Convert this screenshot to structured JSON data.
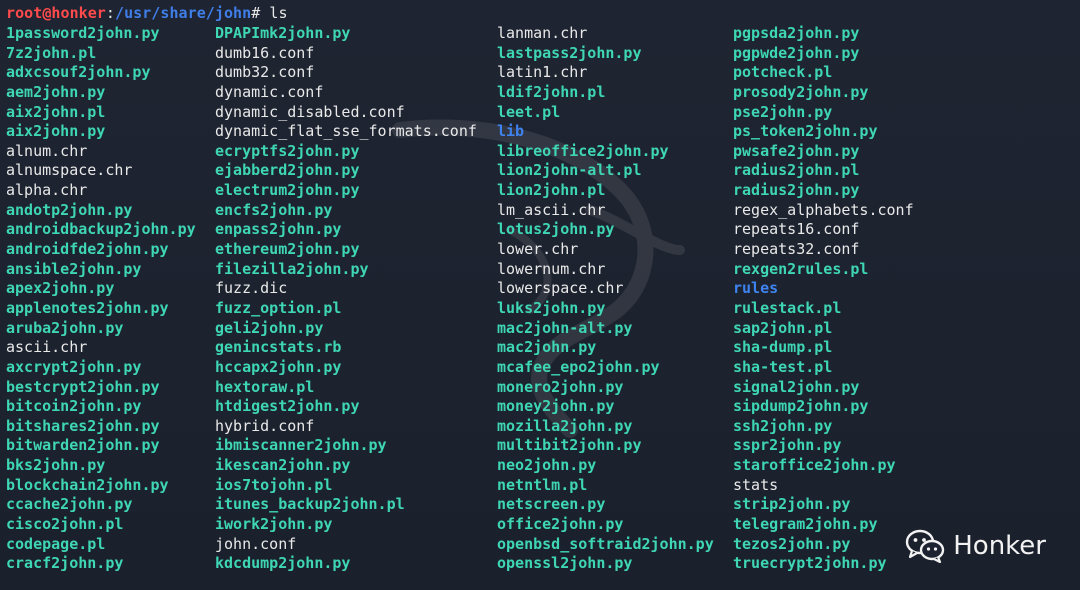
{
  "prompt": {
    "user_host": "root@honker",
    "separator": ":",
    "path": "/usr/share/john",
    "symbol": "#",
    "command": "ls"
  },
  "watermark": {
    "text": "Honker",
    "icon": "wechat-icon",
    "background_icon": "kali-dragon-icon"
  },
  "colors": {
    "background": "#1d2330",
    "executable": "#3ed6b4",
    "directory": "#3e83f0",
    "plain": "#e9e9e9",
    "prompt_user": "#ff4b4b"
  },
  "columns": [
    [
      {
        "name": "1password2john.py",
        "type": "exec"
      },
      {
        "name": "7z2john.pl",
        "type": "exec"
      },
      {
        "name": "adxcsouf2john.py",
        "type": "exec"
      },
      {
        "name": "aem2john.py",
        "type": "exec"
      },
      {
        "name": "aix2john.pl",
        "type": "exec"
      },
      {
        "name": "aix2john.py",
        "type": "exec"
      },
      {
        "name": "alnum.chr",
        "type": "plain"
      },
      {
        "name": "alnumspace.chr",
        "type": "plain"
      },
      {
        "name": "alpha.chr",
        "type": "plain"
      },
      {
        "name": "andotp2john.py",
        "type": "exec"
      },
      {
        "name": "androidbackup2john.py",
        "type": "exec"
      },
      {
        "name": "androidfde2john.py",
        "type": "exec"
      },
      {
        "name": "ansible2john.py",
        "type": "exec"
      },
      {
        "name": "apex2john.py",
        "type": "exec"
      },
      {
        "name": "applenotes2john.py",
        "type": "exec"
      },
      {
        "name": "aruba2john.py",
        "type": "exec"
      },
      {
        "name": "ascii.chr",
        "type": "plain"
      },
      {
        "name": "axcrypt2john.py",
        "type": "exec"
      },
      {
        "name": "bestcrypt2john.py",
        "type": "exec"
      },
      {
        "name": "bitcoin2john.py",
        "type": "exec"
      },
      {
        "name": "bitshares2john.py",
        "type": "exec"
      },
      {
        "name": "bitwarden2john.py",
        "type": "exec"
      },
      {
        "name": "bks2john.py",
        "type": "exec"
      },
      {
        "name": "blockchain2john.py",
        "type": "exec"
      },
      {
        "name": "ccache2john.py",
        "type": "exec"
      },
      {
        "name": "cisco2john.pl",
        "type": "exec"
      },
      {
        "name": "codepage.pl",
        "type": "exec"
      },
      {
        "name": "cracf2john.py",
        "type": "exec"
      }
    ],
    [
      {
        "name": "DPAPImk2john.py",
        "type": "exec"
      },
      {
        "name": "dumb16.conf",
        "type": "plain"
      },
      {
        "name": "dumb32.conf",
        "type": "plain"
      },
      {
        "name": "dynamic.conf",
        "type": "plain"
      },
      {
        "name": "dynamic_disabled.conf",
        "type": "plain"
      },
      {
        "name": "dynamic_flat_sse_formats.conf",
        "type": "plain"
      },
      {
        "name": "ecryptfs2john.py",
        "type": "exec"
      },
      {
        "name": "ejabberd2john.py",
        "type": "exec"
      },
      {
        "name": "electrum2john.py",
        "type": "exec"
      },
      {
        "name": "encfs2john.py",
        "type": "exec"
      },
      {
        "name": "enpass2john.py",
        "type": "exec"
      },
      {
        "name": "ethereum2john.py",
        "type": "exec"
      },
      {
        "name": "filezilla2john.py",
        "type": "exec"
      },
      {
        "name": "fuzz.dic",
        "type": "plain"
      },
      {
        "name": "fuzz_option.pl",
        "type": "exec"
      },
      {
        "name": "geli2john.py",
        "type": "exec"
      },
      {
        "name": "genincstats.rb",
        "type": "exec"
      },
      {
        "name": "hccapx2john.py",
        "type": "exec"
      },
      {
        "name": "hextoraw.pl",
        "type": "exec"
      },
      {
        "name": "htdigest2john.py",
        "type": "exec"
      },
      {
        "name": "hybrid.conf",
        "type": "plain"
      },
      {
        "name": "ibmiscanner2john.py",
        "type": "exec"
      },
      {
        "name": "ikescan2john.py",
        "type": "exec"
      },
      {
        "name": "ios7tojohn.pl",
        "type": "exec"
      },
      {
        "name": "itunes_backup2john.pl",
        "type": "exec"
      },
      {
        "name": "iwork2john.py",
        "type": "exec"
      },
      {
        "name": "john.conf",
        "type": "plain"
      },
      {
        "name": "kdcdump2john.py",
        "type": "exec"
      }
    ],
    [
      {
        "name": "lanman.chr",
        "type": "plain"
      },
      {
        "name": "lastpass2john.py",
        "type": "exec"
      },
      {
        "name": "latin1.chr",
        "type": "plain"
      },
      {
        "name": "ldif2john.pl",
        "type": "exec"
      },
      {
        "name": "leet.pl",
        "type": "exec"
      },
      {
        "name": "lib",
        "type": "dir"
      },
      {
        "name": "libreoffice2john.py",
        "type": "exec"
      },
      {
        "name": "lion2john-alt.pl",
        "type": "exec"
      },
      {
        "name": "lion2john.pl",
        "type": "exec"
      },
      {
        "name": "lm_ascii.chr",
        "type": "plain"
      },
      {
        "name": "lotus2john.py",
        "type": "exec"
      },
      {
        "name": "lower.chr",
        "type": "plain"
      },
      {
        "name": "lowernum.chr",
        "type": "plain"
      },
      {
        "name": "lowerspace.chr",
        "type": "plain"
      },
      {
        "name": "luks2john.py",
        "type": "exec"
      },
      {
        "name": "mac2john-alt.py",
        "type": "exec"
      },
      {
        "name": "mac2john.py",
        "type": "exec"
      },
      {
        "name": "mcafee_epo2john.py",
        "type": "exec"
      },
      {
        "name": "monero2john.py",
        "type": "exec"
      },
      {
        "name": "money2john.py",
        "type": "exec"
      },
      {
        "name": "mozilla2john.py",
        "type": "exec"
      },
      {
        "name": "multibit2john.py",
        "type": "exec"
      },
      {
        "name": "neo2john.py",
        "type": "exec"
      },
      {
        "name": "netntlm.pl",
        "type": "exec"
      },
      {
        "name": "netscreen.py",
        "type": "exec"
      },
      {
        "name": "office2john.py",
        "type": "exec"
      },
      {
        "name": "openbsd_softraid2john.py",
        "type": "exec"
      },
      {
        "name": "openssl2john.py",
        "type": "exec"
      }
    ],
    [
      {
        "name": "pgpsda2john.py",
        "type": "exec"
      },
      {
        "name": "pgpwde2john.py",
        "type": "exec"
      },
      {
        "name": "potcheck.pl",
        "type": "exec"
      },
      {
        "name": "prosody2john.py",
        "type": "exec"
      },
      {
        "name": "pse2john.py",
        "type": "exec"
      },
      {
        "name": "ps_token2john.py",
        "type": "exec"
      },
      {
        "name": "pwsafe2john.py",
        "type": "exec"
      },
      {
        "name": "radius2john.pl",
        "type": "exec"
      },
      {
        "name": "radius2john.py",
        "type": "exec"
      },
      {
        "name": "regex_alphabets.conf",
        "type": "plain"
      },
      {
        "name": "repeats16.conf",
        "type": "plain"
      },
      {
        "name": "repeats32.conf",
        "type": "plain"
      },
      {
        "name": "rexgen2rules.pl",
        "type": "exec"
      },
      {
        "name": "rules",
        "type": "dir"
      },
      {
        "name": "rulestack.pl",
        "type": "exec"
      },
      {
        "name": "sap2john.pl",
        "type": "exec"
      },
      {
        "name": "sha-dump.pl",
        "type": "exec"
      },
      {
        "name": "sha-test.pl",
        "type": "exec"
      },
      {
        "name": "signal2john.py",
        "type": "exec"
      },
      {
        "name": "sipdump2john.py",
        "type": "exec"
      },
      {
        "name": "ssh2john.py",
        "type": "exec"
      },
      {
        "name": "sspr2john.py",
        "type": "exec"
      },
      {
        "name": "staroffice2john.py",
        "type": "exec"
      },
      {
        "name": "stats",
        "type": "plain"
      },
      {
        "name": "strip2john.py",
        "type": "exec"
      },
      {
        "name": "telegram2john.py",
        "type": "exec"
      },
      {
        "name": "tezos2john.py",
        "type": "exec"
      },
      {
        "name": "truecrypt2john.py",
        "type": "exec"
      }
    ]
  ]
}
